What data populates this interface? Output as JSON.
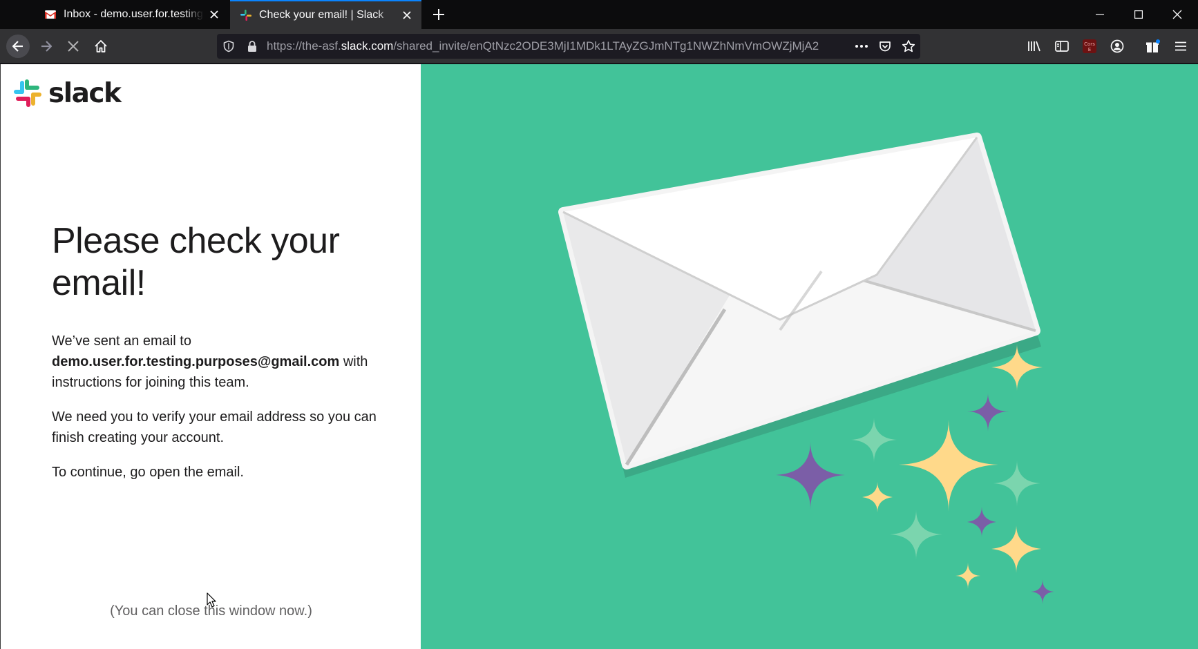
{
  "browser": {
    "tabs": [
      {
        "title": "Inbox - demo.user.for.testing.purposes@gmail.com - Gmail",
        "favicon": "gmail-icon",
        "active": false
      },
      {
        "title": "Check your email! | Slack",
        "favicon": "slack-icon",
        "active": true
      }
    ],
    "url": {
      "prefix": "https://the-asf.",
      "host": "slack.com",
      "path": "/shared_invite/enQtNzc2ODE3MjI1MDk1LTAyZGJmNTg1NWZhNmVmOWZjMjA2"
    },
    "accent_color": "#0a84ff"
  },
  "page": {
    "logo_text": "slack",
    "headline": "Please check your email!",
    "paragraph1": {
      "before": "We’ve sent an email to",
      "email": "demo.user.for.testing.purposes@gmail.com",
      "after": "with instructions for joining this team."
    },
    "paragraph2": "We need you to verify your email address so you can finish creating your account.",
    "paragraph3": "To continue, go open the email.",
    "close_note": "(You can close this window now.)",
    "colors": {
      "background_right": "#42c399",
      "text": "#1d1c1d",
      "sparkle_yellow": "#ffd98a",
      "sparkle_purple": "#7b5ea7",
      "sparkle_green": "#7bd5ae"
    }
  }
}
